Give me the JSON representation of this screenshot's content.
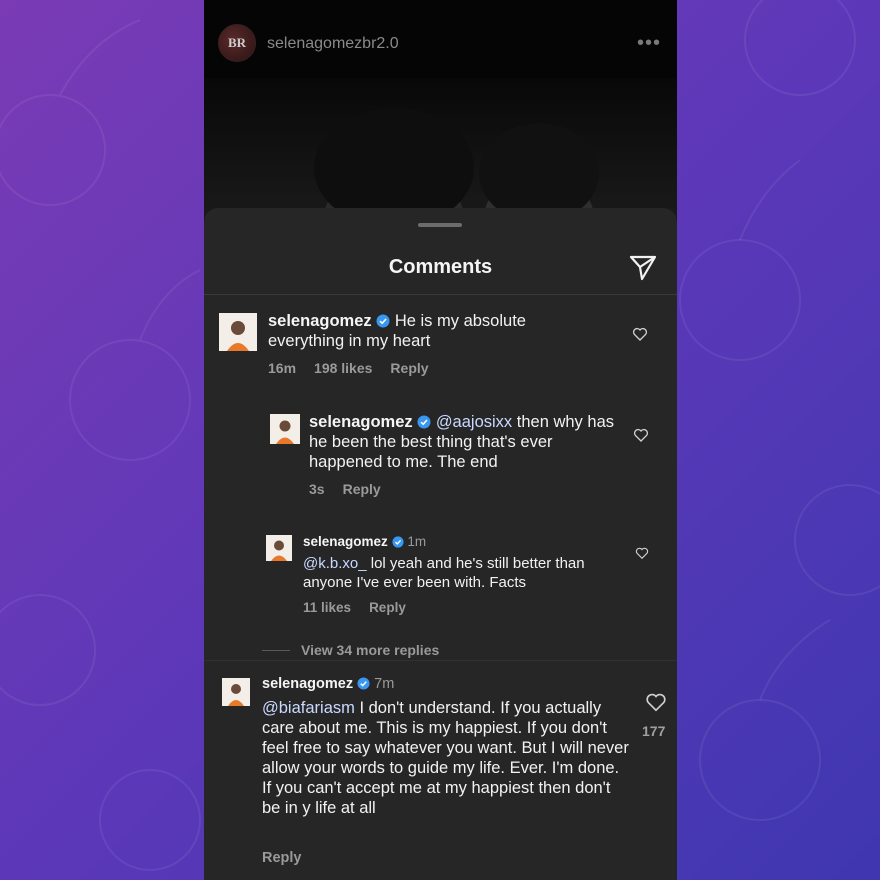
{
  "post": {
    "avatar_text": "BR",
    "username": "selenagomezbr2.0",
    "more_icon": "more-dots-icon"
  },
  "sheet": {
    "title": "Comments"
  },
  "comments": [
    {
      "username": "selenagomez",
      "text": "He is my absolute everything in my heart",
      "time": "16m",
      "likes": "198 likes",
      "reply": "Reply"
    },
    {
      "username": "selenagomez",
      "mention": "@aajosixx",
      "text": " then why has he been the best thing that's ever happened to me. The end",
      "time": "3s",
      "reply": "Reply"
    },
    {
      "username": "selenagomez",
      "time": "1m",
      "mention": "@k.b.xo_",
      "text": " lol yeah and he's still better than anyone I've ever been with. Facts",
      "likes": "11 likes",
      "reply": "Reply"
    },
    {
      "username": "selenagomez",
      "time": "7m",
      "mention": "@biafariasm",
      "text": " I don't understand. If you actually care about me. This is my happiest. If you don't feel free to say whatever you want. But I will never allow your words to guide my life. Ever. I'm done. If you can't accept me at my happiest then don't be in y life at all",
      "like_count": "177",
      "reply": "Reply"
    }
  ],
  "view_more": "View 34 more replies",
  "colors": {
    "sheet_bg": "#262626",
    "verified": "#3897f0",
    "mention": "#c9d9ff"
  }
}
